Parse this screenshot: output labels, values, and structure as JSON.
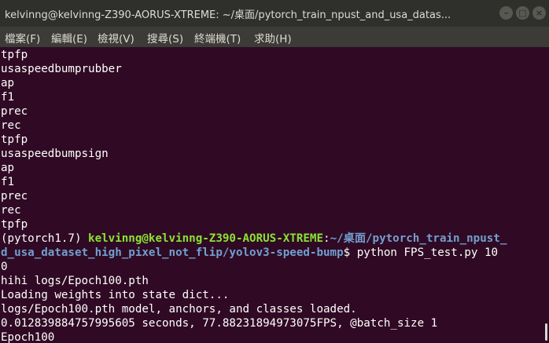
{
  "window": {
    "title": "kelvinng@kelvinng-Z390-AORUS-XTREME: ~/桌面/pytorch_train_npust_and_usa_datas...",
    "minimize_glyph": "–",
    "maximize_glyph": "□",
    "close_glyph": "×"
  },
  "menu": {
    "file": "檔案(F)",
    "edit": "編輯(E)",
    "view": "檢視(V)",
    "search": "搜尋(S)",
    "terminal": "終端機(T)",
    "help": "求助(H)"
  },
  "terminal": {
    "lines": [
      "tpfp",
      "usaspeedbumprubber",
      "ap",
      "f1",
      "prec",
      "rec",
      "tpfp",
      "usaspeedbumpsign",
      "ap",
      "f1",
      "prec",
      "rec",
      "tpfp"
    ],
    "prompt": {
      "env": "(pytorch1.7) ",
      "userhost": "kelvinng@kelvinng-Z390-AORUS-XTREME",
      "colon": ":",
      "path_line1": "~/桌面/pytorch_train_npust_",
      "path_line2": "d_usa_dataset_high_pixel_not_flip/yolov3-speed-bump",
      "symbol": "$",
      "command": " python FPS_test.py 10"
    },
    "output": [
      "0",
      "hihi logs/Epoch100.pth",
      "Loading weights into state dict...",
      "logs/Epoch100.pth model, anchors, and classes loaded.",
      "0.012839884757995605 seconds, 77.88231894973075FPS, @batch_size 1",
      "Epoch100"
    ]
  },
  "colors": {
    "background": "#300a24",
    "prompt_green": "#8ae234",
    "prompt_blue": "#729fcf",
    "text": "#ffffff"
  }
}
